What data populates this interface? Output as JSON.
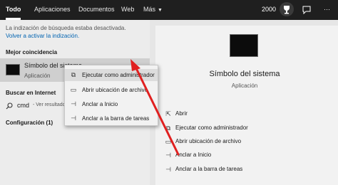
{
  "tabs": [
    {
      "label": "Todo"
    },
    {
      "label": "Aplicaciones"
    },
    {
      "label": "Documentos"
    },
    {
      "label": "Web"
    },
    {
      "label": "Más"
    }
  ],
  "topbar": {
    "points": "2000"
  },
  "notice": {
    "text": "La indización de búsqueda estaba desactivada.",
    "link": "Volver a activar la indización."
  },
  "sections": {
    "best": "Mejor coincidencia",
    "web": "Buscar en Internet",
    "config": "Configuración (1)"
  },
  "best_match": {
    "title": "Símbolo del sistema",
    "subtitle": "Aplicación"
  },
  "web_result": {
    "query": "cmd",
    "hint": "- Ver resultados web"
  },
  "context_menu": [
    {
      "label": "Ejecutar como administrador",
      "icon": "shield-window-icon"
    },
    {
      "label": "Abrir ubicación de archivo",
      "icon": "folder-icon"
    },
    {
      "label": "Anclar a Inicio",
      "icon": "pin-icon"
    },
    {
      "label": "Anclar a la barra de tareas",
      "icon": "pin-icon"
    }
  ],
  "detail": {
    "title": "Símbolo del sistema",
    "subtitle": "Aplicación"
  },
  "actions": [
    {
      "label": "Abrir",
      "icon": "open-icon"
    },
    {
      "label": "Ejecutar como administrador",
      "icon": "shield-window-icon"
    },
    {
      "label": "Abrir ubicación de archivo",
      "icon": "folder-icon"
    },
    {
      "label": "Anclar a Inicio",
      "icon": "pin-icon"
    },
    {
      "label": "Anclar a la barra de tareas",
      "icon": "pin-icon"
    }
  ],
  "colors": {
    "topbar": "#1f1f1f",
    "arrow": "#e02020",
    "highlight": "#cfcfcf"
  }
}
